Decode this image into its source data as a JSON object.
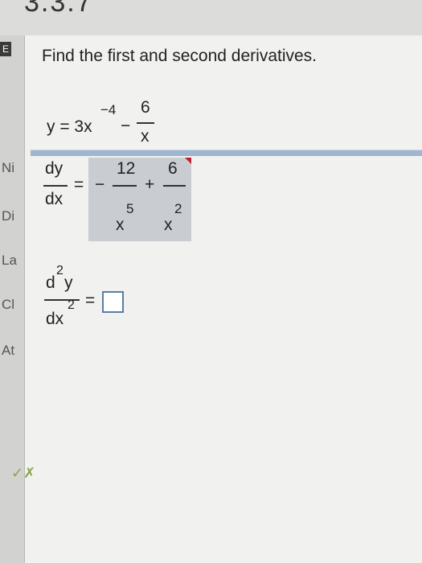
{
  "header": {
    "section_number": "3.3.7"
  },
  "left_rail": {
    "labels": [
      "Ni",
      "Di",
      "La",
      "Cl",
      "At"
    ]
  },
  "question": {
    "icon_label": "E",
    "prompt": "Find the first and second derivatives.",
    "function": {
      "lhs": "y = 3x",
      "exponent": "−4",
      "minus": "−",
      "frac_num": "6",
      "frac_den": "x"
    }
  },
  "first_derivative": {
    "num": "dy",
    "den": "dx",
    "equals": "=",
    "sign": "−",
    "term1_num": "12",
    "term1_den": "x",
    "term1_den_exp": "5",
    "plus": "+",
    "term2_num": "6",
    "term2_den": "x",
    "term2_den_exp": "2"
  },
  "second_derivative": {
    "num_base": "d",
    "num_exp": "2",
    "num_var": "y",
    "den_base": "dx",
    "den_exp": "2",
    "equals": "="
  },
  "colors": {
    "accent": "#9fb6cf",
    "answer_bg": "#c9ccd1",
    "flag": "#c0202a",
    "input_border": "#5a7ca8"
  },
  "icons": {
    "correct_mark": "check-x-icon"
  }
}
